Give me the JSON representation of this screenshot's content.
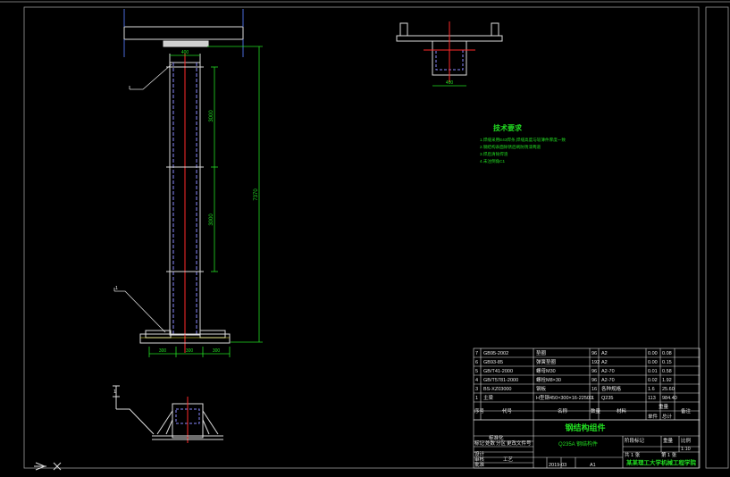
{
  "drawing": {
    "dims": {
      "upper_span": "3000",
      "lower_span": "3000",
      "total_height": "7370",
      "top_width": "400",
      "base_left": "300",
      "base_mid": "300",
      "base_right": "300",
      "section_width": "400"
    },
    "marks": {
      "m1": "1",
      "m2": "1",
      "m3": "1"
    },
    "technical_requirements": {
      "title": "技术要求",
      "lines": [
        "1.焊缝采用E43焊条,焊缝高度与较薄件厚度一致",
        "2.钢结构表面除锈后刷防锈漆两道",
        "3.焊后清除焊渣",
        "4.未注倒角C1"
      ]
    },
    "bom": {
      "rows": [
        {
          "no": "7",
          "code": "GB95-2002",
          "name": "垫圈",
          "qty": "96",
          "material": "A2",
          "unit_weight": "0.00",
          "total_weight": "0.08"
        },
        {
          "no": "6",
          "code": "GB93-85",
          "name": "弹簧垫圈",
          "qty": "192",
          "material": "A2",
          "unit_weight": "0.00",
          "total_weight": "0.15"
        },
        {
          "no": "5",
          "code": "GB/T41-2000",
          "name": "螺母M30",
          "qty": "96",
          "material": "A2-70",
          "unit_weight": "0.01",
          "total_weight": "0.58"
        },
        {
          "no": "4",
          "code": "GB/T5781-2000",
          "name": "螺栓M8×30",
          "qty": "96",
          "material": "A2-70",
          "unit_weight": "0.02",
          "total_weight": "1.92"
        },
        {
          "no": "3",
          "code": "BS-XZ03000",
          "name": "钢板",
          "qty": "16",
          "material": "各种规格",
          "unit_weight": "1.6",
          "total_weight": "25.60"
        },
        {
          "no": "1",
          "code": "主梁",
          "name": "H型钢450×300×16-22500",
          "qty": "1",
          "material": "Q235",
          "unit_weight": "113",
          "total_weight": "984.40"
        }
      ],
      "headers": [
        "序号",
        "代号",
        "名称",
        "数量",
        "材料",
        "单件",
        "总计",
        "备注"
      ],
      "weight_header": "重量"
    },
    "title_block": {
      "part_name": "钢结构组件",
      "material": "Q235A 钢结构件",
      "school": "某某理工大学机械工程学院",
      "designer": "标准化",
      "stage_label": "阶段标记",
      "weight_label": "重量",
      "scale_label": "比例",
      "scale": "1:10",
      "sheet_label": "共 1 张",
      "sheet_no": "第 1 张",
      "format": "A1",
      "date": "2019-03",
      "row_labels": [
        "标记",
        "处数",
        "分区",
        "更改文件号",
        "签名",
        "年月日"
      ],
      "role_labels": [
        "设计",
        "审核",
        "工艺",
        "批准"
      ]
    }
  }
}
